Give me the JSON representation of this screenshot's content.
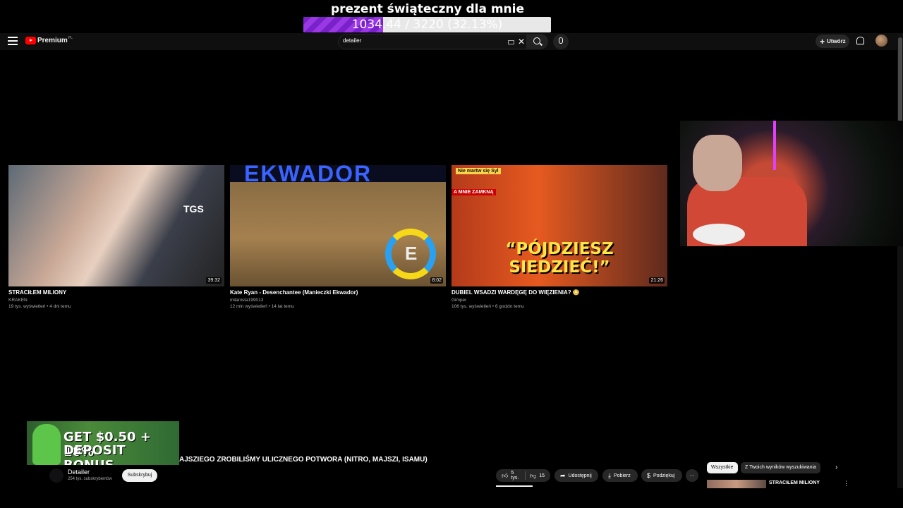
{
  "overlay": {
    "goal_title": "prezent świąteczny dla mnie",
    "goal_text": "1034.44 / 3220 (32.13%)",
    "goal_progress": 0.3213
  },
  "header": {
    "logo_text": "Premium",
    "logo_region": "PL",
    "search_value": "detailer",
    "create_label": "Utwórz"
  },
  "videos": [
    {
      "title": "STRACIŁEM MILIONY",
      "channel": "KRAKEN",
      "meta": "19 tys. wyświetleń • 4 dni temu",
      "duration": "39:32",
      "thumb_text": "TGS"
    },
    {
      "title": "Kate Ryan - Desenchantee (Manieczki Ekwador)",
      "channel": "milanista199013",
      "meta": "12 mln wyświetleń • 14 lat temu",
      "duration": "8:02",
      "thumb_text": "EKWADOR"
    },
    {
      "title": "DUBIEL WSADZI WARDĘGĘ DO WIĘZIENIA? 😳",
      "channel": "Gimper",
      "meta": "106 tys. wyświetleń • 6 godzin temu",
      "duration": "21:26",
      "thumb_text": "“PÓJDZIESZ SIEDZIEĆ!”",
      "tag1": "Nie martw się Syl",
      "tag2": "A MNIE ZAMKNĄ"
    }
  ],
  "ad": {
    "line1": "GET $0.50 + 10%",
    "line2": "DEPOSIT BONUS"
  },
  "player": {
    "title": "AJSZIEGO ZROBILIŚMY ULICZNEGO POTWORA (NITRO, MAJSZI, ISAMU)",
    "channel_name": "Detailer",
    "channel_subs": "254 tys. subskrybentów",
    "subscribe_label": "Subskrybuj",
    "likes": "5 tys.",
    "dislikes": "15",
    "share_label": "Udostępnij",
    "download_label": "Pobierz",
    "thanks_label": "Podziękuj"
  },
  "sidebar": {
    "chip_all": "Wszystkie",
    "chip_yours": "Z Twoich wyników wyszukiwania",
    "up_next_title": "STRACIŁEM MILIONY"
  }
}
